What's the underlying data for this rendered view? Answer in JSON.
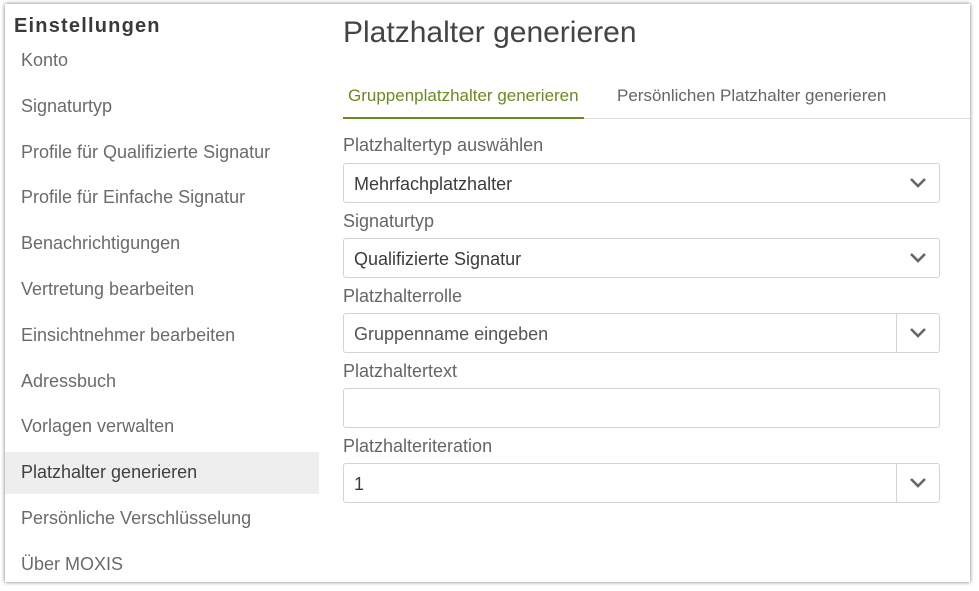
{
  "sidebar": {
    "title": "Einstellungen",
    "items": [
      {
        "label": "Konto"
      },
      {
        "label": "Signaturtyp"
      },
      {
        "label": "Profile für Qualifizierte Signatur"
      },
      {
        "label": "Profile für Einfache Signatur"
      },
      {
        "label": "Benachrichtigungen"
      },
      {
        "label": "Vertretung bearbeiten"
      },
      {
        "label": "Einsichtnehmer bearbeiten"
      },
      {
        "label": "Adressbuch"
      },
      {
        "label": "Vorlagen verwalten"
      },
      {
        "label": "Platzhalter generieren",
        "active": true
      },
      {
        "label": "Persönliche Verschlüsselung"
      },
      {
        "label": "Über MOXIS"
      }
    ]
  },
  "main": {
    "title": "Platzhalter generieren",
    "tabs": [
      {
        "label": "Gruppenplatzhalter generieren",
        "active": true
      },
      {
        "label": "Persönlichen Platzhalter generieren",
        "active": false
      }
    ],
    "form": {
      "placeholder_type": {
        "label": "Platzhaltertyp auswählen",
        "value": "Mehrfachplatzhalter"
      },
      "signature_type": {
        "label": "Signaturtyp",
        "value": "Qualifizierte Signatur"
      },
      "placeholder_role": {
        "label": "Platzhalterrolle",
        "placeholder": "Gruppenname eingeben"
      },
      "placeholder_text": {
        "label": "Platzhaltertext",
        "value": ""
      },
      "placeholder_iteration": {
        "label": "Platzhalteriteration",
        "value": "1"
      }
    }
  },
  "colors": {
    "accent": "#6b8a1f",
    "active_bg": "#eeeeee",
    "border": "#d4d4d4"
  },
  "icons": {
    "dropdown": "chevron-down-icon"
  }
}
